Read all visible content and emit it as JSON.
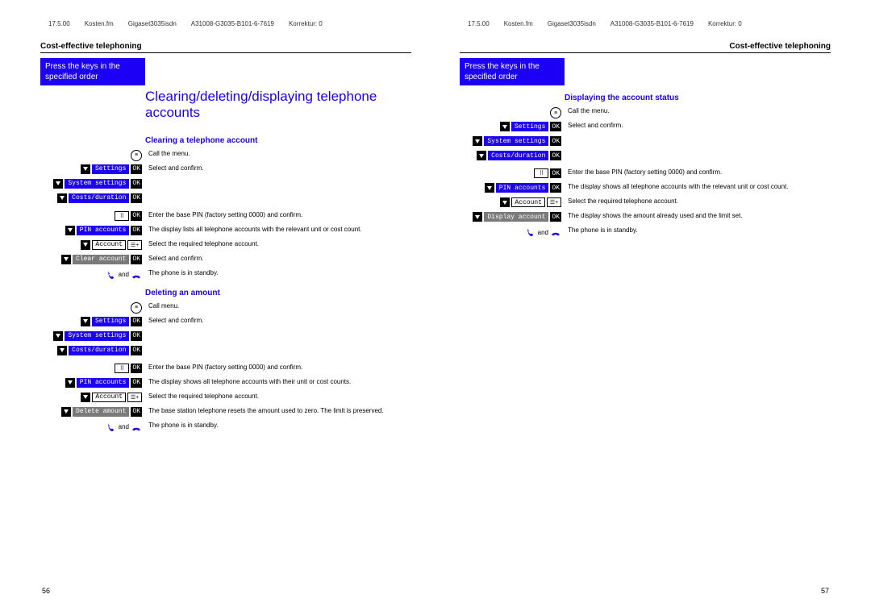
{
  "meta": {
    "date": "17.5.00",
    "file": "Kosten.fm",
    "device": "Gigaset3035isdn",
    "doc": "A31008-G3035-B101-6-7619",
    "corr": "Korrektur: 0"
  },
  "section_title": "Cost-effective telephoning",
  "blue_bar": "Press the keys in the specified order",
  "chapter_title": "Clearing/deleting/displaying telephone accounts",
  "ok": "OK",
  "and": "and",
  "labels": {
    "settings": "Settings",
    "system": "System settings",
    "costs": "Costs/duration",
    "pin": "PIN accounts",
    "account": "Account",
    "clear": "Clear account",
    "delete": "Delete amount",
    "display": "Display account"
  },
  "sections": {
    "clearing": {
      "title": "Clearing a telephone account",
      "s1": "Call the menu.",
      "s2": "Select and confirm.",
      "s3": "Enter the base PIN (factory setting 0000) and confirm.",
      "s4": "The display lists all telephone accounts with the relevant unit or cost count.",
      "s5": "Select the required telephone account.",
      "s6": "Select and confirm.",
      "s7": "The phone is in standby."
    },
    "deleting": {
      "title": "Deleting an amount",
      "s1": "Call menu.",
      "s2": "Select and confirm.",
      "s3": "Enter the base PIN (factory setting 0000) and confirm.",
      "s4": "The display shows all telephone accounts with their unit or cost counts.",
      "s5": "Select the required telephone account.",
      "s6": "The base station telephone resets the amount used to zero. The limit is preserved.",
      "s7": "The phone is in standby."
    },
    "displaying": {
      "title": "Displaying the account status",
      "s1": "Call the menu.",
      "s2": "Select and confirm.",
      "s3": "Enter the base PIN (factory setting 0000) and confirm.",
      "s4": "The display shows all telephone accounts with the relevant unit or cost count.",
      "s5": "Select the required telephone account.",
      "s6": "The display shows the amount already used and the limit set.",
      "s7": "The phone is in standby."
    }
  },
  "page_left": "56",
  "page_right": "57"
}
